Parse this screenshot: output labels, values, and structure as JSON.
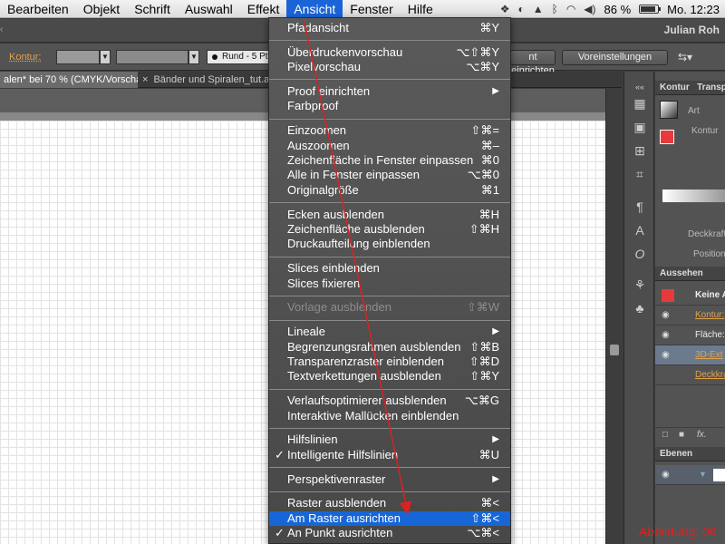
{
  "menubar": {
    "items": [
      "Bearbeiten",
      "Objekt",
      "Schrift",
      "Auswahl",
      "Effekt",
      "Ansicht",
      "Fenster",
      "Hilfe"
    ],
    "active": "Ansicht",
    "battery_percent": "86 %",
    "battery_level": 0.86,
    "clock": "Mo. 12:23"
  },
  "appbar": {
    "user": "Julian Roh"
  },
  "controlbar": {
    "kontur_label": "Kontur:",
    "stroke_style": "Rund - 5 Pt.",
    "button_1": "nt einrichten",
    "button_2": "Voreinstellungen"
  },
  "tabs": {
    "active": "alen* bei 70 % (CMYK/Vorschau)",
    "inactive": "Bänder und Spiralen_tut.ai bei",
    "close": "×"
  },
  "panels": {
    "tab_kontur": "Kontur",
    "tab_transp": "Transp",
    "label_art": "Art",
    "label_kontur": "Kontur",
    "label_deckkraft": "Deckkraft",
    "label_position": "Position",
    "tab_aussehen": "Aussehen",
    "row_keine": "Keine A",
    "row_kontur": "Kontur:",
    "row_flaeche": "Fläche:",
    "row_3d": "3D-Ext",
    "row_deckkraft": "Deckkra",
    "fx": "fx.",
    "tab_ebenen": "Ebenen",
    "accent_orange": "#e3a24a",
    "accent_red": "#e83a3a"
  },
  "menu": {
    "items": [
      {
        "label": "Pfadansicht",
        "shortcut": "⌘Y"
      },
      {
        "sep": true
      },
      {
        "label": "Überdruckenvorschau",
        "shortcut": "⌥⇧⌘Y"
      },
      {
        "label": "Pixelvorschau",
        "shortcut": "⌥⌘Y"
      },
      {
        "sep": true
      },
      {
        "label": "Proof einrichten",
        "submenu": true
      },
      {
        "label": "Farbproof"
      },
      {
        "sep": true
      },
      {
        "label": "Einzoomen",
        "shortcut": "⇧⌘="
      },
      {
        "label": "Auszoomen",
        "shortcut": "⌘–"
      },
      {
        "label": "Zeichenfläche in Fenster einpassen",
        "shortcut": "⌘0"
      },
      {
        "label": "Alle in Fenster einpassen",
        "shortcut": "⌥⌘0"
      },
      {
        "label": "Originalgröße",
        "shortcut": "⌘1"
      },
      {
        "sep": true
      },
      {
        "label": "Ecken ausblenden",
        "shortcut": "⌘H"
      },
      {
        "label": "Zeichenfläche ausblenden",
        "shortcut": "⇧⌘H"
      },
      {
        "label": "Druckaufteilung einblenden"
      },
      {
        "sep": true
      },
      {
        "label": "Slices einblenden"
      },
      {
        "label": "Slices fixieren"
      },
      {
        "sep": true
      },
      {
        "label": "Vorlage ausblenden",
        "shortcut": "⇧⌘W",
        "disabled": true
      },
      {
        "sep": true
      },
      {
        "label": "Lineale",
        "submenu": true
      },
      {
        "label": "Begrenzungsrahmen ausblenden",
        "shortcut": "⇧⌘B"
      },
      {
        "label": "Transparenzraster einblenden",
        "shortcut": "⇧⌘D"
      },
      {
        "label": "Textverkettungen ausblenden",
        "shortcut": "⇧⌘Y"
      },
      {
        "sep": true
      },
      {
        "label": "Verlaufsoptimierer ausblenden",
        "shortcut": "⌥⌘G"
      },
      {
        "label": "Interaktive Mallücken einblenden"
      },
      {
        "sep": true
      },
      {
        "label": "Hilfslinien",
        "submenu": true
      },
      {
        "label": "Intelligente Hilfslinien",
        "shortcut": "⌘U",
        "checked": true
      },
      {
        "sep": true
      },
      {
        "label": "Perspektivenraster",
        "submenu": true
      },
      {
        "sep": true
      },
      {
        "label": "Raster ausblenden",
        "shortcut": "⌘<"
      },
      {
        "label": "Am Raster ausrichten",
        "shortcut": "⇧⌘<",
        "selected": true
      },
      {
        "label": "An Punkt ausrichten",
        "shortcut": "⌥⌘<",
        "checked": true
      }
    ],
    "submenu_arrow": "▶",
    "check_mark": "✓"
  },
  "annotation": {
    "caption": "Abbildung: 06",
    "color": "#e02020"
  }
}
